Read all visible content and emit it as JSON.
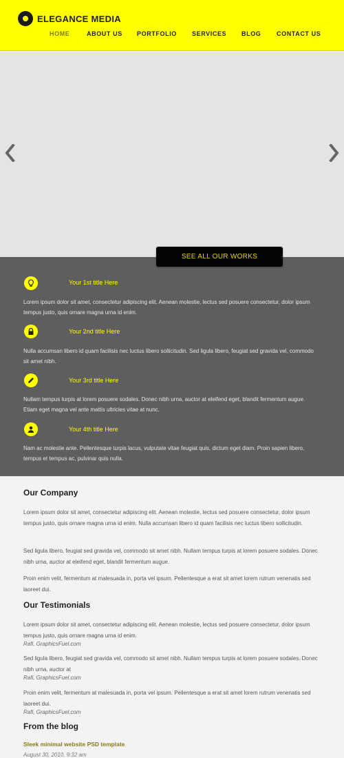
{
  "brand": {
    "name": "ELEGANCE MEDIA"
  },
  "nav": {
    "items": [
      {
        "label": "HOME",
        "active": true
      },
      {
        "label": "ABOUT US"
      },
      {
        "label": "PORTFOLIO"
      },
      {
        "label": "SERVICES"
      },
      {
        "label": "BLOG"
      },
      {
        "label": "CONTACT US"
      }
    ]
  },
  "slider": {
    "prev_icon": "chevron-left",
    "next_icon": "chevron-right"
  },
  "works_button": {
    "label": "SEE ALL OUR WORKS"
  },
  "features": [
    {
      "icon": "lightbulb",
      "title": "Your 1st title Here",
      "text": "Lorem ipsum dolor sit amet, consectetur adipiscing elit. Aenean molestie, lectus sed posuere consectetur, dolor ipsum tempus justo, quis ornare magna urna id enim."
    },
    {
      "icon": "lock",
      "title": "Your 2nd title Here",
      "text": "Nulla accumsan libero id quam facilisis nec luctus libero sollicitudin. Sed ligula libero, feugiat sed gravida vel, commodo sit amet nibh."
    },
    {
      "icon": "pencil",
      "title": "Your 3rd title Here",
      "text": "Nullam tempus turpis at lorem posuere sodales. Donec nibh urna, auctor at eleifend eget, blandit fermentum augue. Etiam eget magna vel ante mattis ultricies vitae at nunc."
    },
    {
      "icon": "user",
      "title": "Your 4th title Here",
      "text": "Nam ac molestie ante. Pellentesque turpis lacus, vulputate vitae feugiat quis, dictum eget diam. Proin sapien libero, tempus et tempus ac, pulvinar quis nulla."
    }
  ],
  "company": {
    "title": "Our Company",
    "paragraphs": [
      "Lorem ipsum dolor sit amet, consectetur adipiscing elit. Aenean molestie, lectus sed posuere consectetur, dolor ipsum tempus justo, quis ornare magna urna id enim. Nulla accumsan libero id quam facilisis nec luctus libero sollicitudin.",
      "Sed ligula libero, feugiat sed gravida vel, commodo sit amet nibh. Nullam tempus turpis at lorem posuere sodales. Donec nibh urna, auctor at eleifend eget, blandit fermentum augue.",
      "Proin enim velit, fermentum at malesuada in, porta vel ipsum. Pellentesque a erat sit amet lorem rutrum venenatis sed laoreet dui."
    ]
  },
  "testimonials": {
    "title": "Our Testimonials",
    "items": [
      {
        "text": "Lorem ipsum dolor sit amet, consectetur adipiscing elit. Aenean molestie, lectus sed posuere consectetur, dolor ipsum tempus justo, quis ornare magna urna id enim.",
        "author": "Rafi, GraphicsFuel.com"
      },
      {
        "text": "Sed ligula libero, feugiat sed gravida vel, commodo sit amet nibh. Nullam tempus turpis at lorem posuere sodales. Donec nibh urna, auctor at",
        "author": "Rafi, GraphicsFuel.com"
      },
      {
        "text": "Proin enim velit, fermentum at malesuada in, porta vel ipsum. Pellentesque a erat sit amet lorem rutrum venenatis sed laoreet dui.",
        "author": "Rafi, GraphicsFuel.com"
      }
    ]
  },
  "blog": {
    "title": "From the blog",
    "posts": [
      {
        "title": "Sleek minimal website PSD template",
        "date": "August 30, 2010, 9:32 am"
      }
    ]
  },
  "colors": {
    "accent": "#ffff00",
    "dark_band": "#5e5e5e",
    "button": "#050505"
  }
}
